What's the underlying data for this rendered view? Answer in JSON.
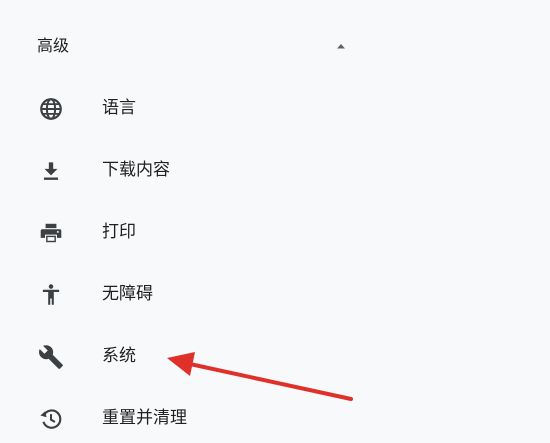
{
  "section": {
    "title": "高级",
    "toggle_icon": "arrow-drop-up-icon"
  },
  "menu": {
    "items": [
      {
        "label": "语言",
        "icon": "globe-icon"
      },
      {
        "label": "下载内容",
        "icon": "download-icon"
      },
      {
        "label": "打印",
        "icon": "printer-icon"
      },
      {
        "label": "无障碍",
        "icon": "accessibility-icon"
      },
      {
        "label": "系统",
        "icon": "wrench-icon"
      },
      {
        "label": "重置并清理",
        "icon": "history-icon"
      }
    ]
  },
  "colors": {
    "panel_background": "#f8f9fa",
    "text": "#202124",
    "icon": "#3c4043",
    "annotation_arrow": "#e0302a"
  }
}
